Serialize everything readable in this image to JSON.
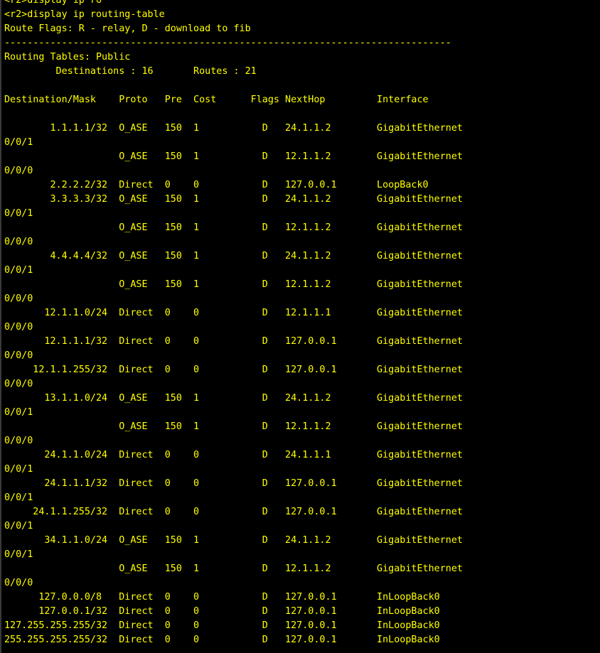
{
  "terminal": {
    "text_color": "#ffff00",
    "background_color": "#000000",
    "lines": [
      "<r2>display ip ro",
      "<r2>display ip routing-table",
      "Route Flags: R - relay, D - download to fib",
      "------------------------------------------------------------------------------",
      "Routing Tables: Public",
      "         Destinations : 16       Routes : 21",
      "",
      "Destination/Mask    Proto   Pre  Cost      Flags NextHop         Interface",
      "",
      "        1.1.1.1/32  O_ASE   150  1           D   24.1.1.2        GigabitEthernet",
      "0/0/1",
      "                    O_ASE   150  1           D   12.1.1.2        GigabitEthernet",
      "0/0/0",
      "        2.2.2.2/32  Direct  0    0           D   127.0.0.1       LoopBack0",
      "        3.3.3.3/32  O_ASE   150  1           D   24.1.1.2        GigabitEthernet",
      "0/0/1",
      "                    O_ASE   150  1           D   12.1.1.2        GigabitEthernet",
      "0/0/0",
      "        4.4.4.4/32  O_ASE   150  1           D   24.1.1.2        GigabitEthernet",
      "0/0/1",
      "                    O_ASE   150  1           D   12.1.1.2        GigabitEthernet",
      "0/0/0",
      "       12.1.1.0/24  Direct  0    0           D   12.1.1.1        GigabitEthernet",
      "0/0/0",
      "       12.1.1.1/32  Direct  0    0           D   127.0.0.1       GigabitEthernet",
      "0/0/0",
      "     12.1.1.255/32  Direct  0    0           D   127.0.0.1       GigabitEthernet",
      "0/0/0",
      "       13.1.1.0/24  O_ASE   150  1           D   24.1.1.2        GigabitEthernet",
      "0/0/1",
      "                    O_ASE   150  1           D   12.1.1.2        GigabitEthernet",
      "0/0/0",
      "       24.1.1.0/24  Direct  0    0           D   24.1.1.1        GigabitEthernet",
      "0/0/1",
      "       24.1.1.1/32  Direct  0    0           D   127.0.0.1       GigabitEthernet",
      "0/0/1",
      "     24.1.1.255/32  Direct  0    0           D   127.0.0.1       GigabitEthernet",
      "0/0/1",
      "       34.1.1.0/24  O_ASE   150  1           D   24.1.1.2        GigabitEthernet",
      "0/0/1",
      "                    O_ASE   150  1           D   12.1.1.2        GigabitEthernet",
      "0/0/0",
      "      127.0.0.0/8   Direct  0    0           D   127.0.0.1       InLoopBack0",
      "      127.0.0.1/32  Direct  0    0           D   127.0.0.1       InLoopBack0",
      "127.255.255.255/32  Direct  0    0           D   127.0.0.1       InLoopBack0",
      "255.255.255.255/32  Direct  0    0           D   127.0.0.1       InLoopBack0"
    ]
  }
}
